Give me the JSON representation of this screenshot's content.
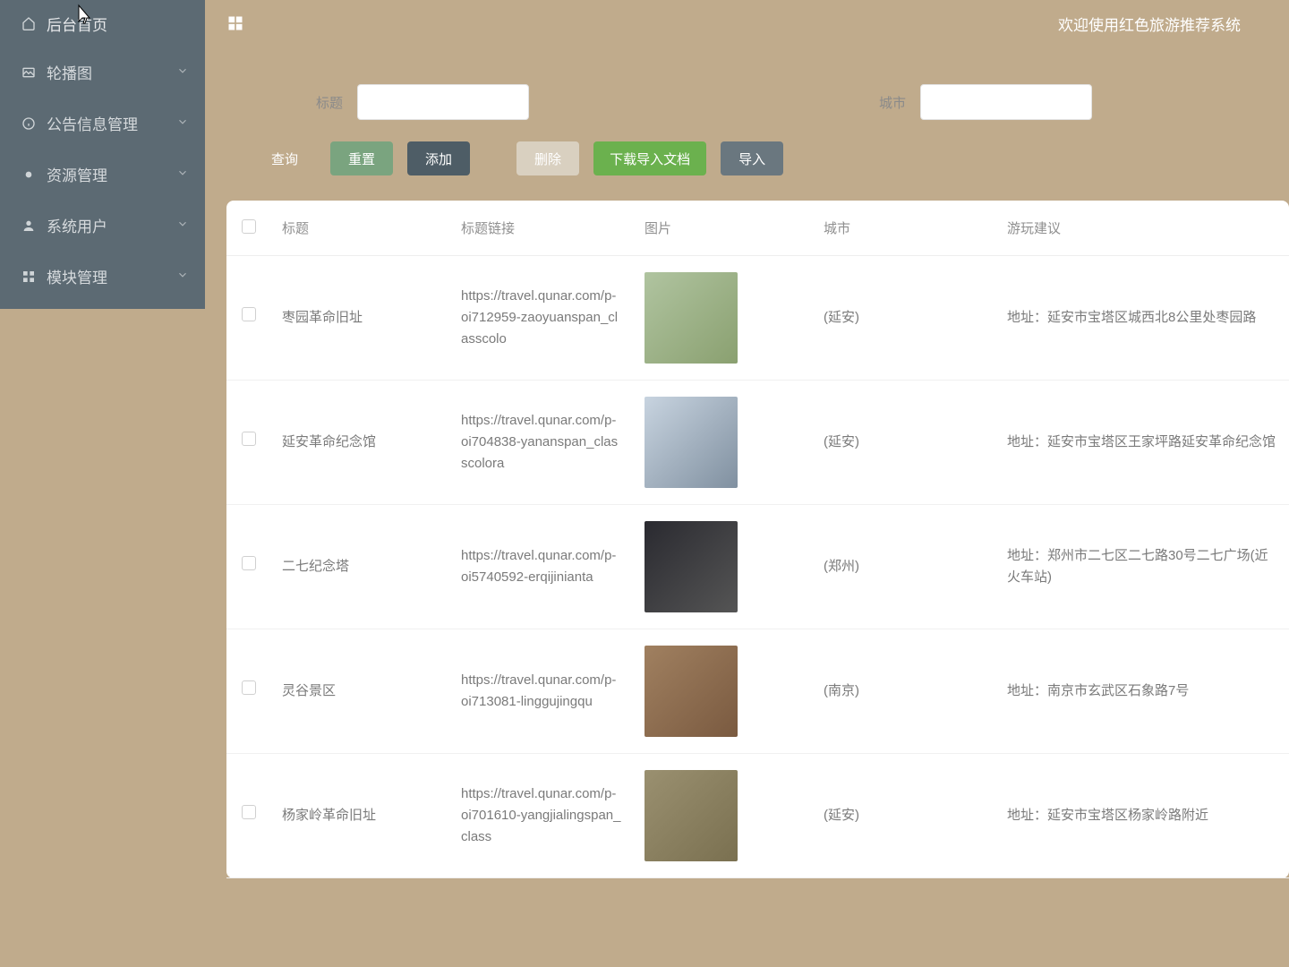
{
  "sidebar": {
    "home_label": "后台首页",
    "items": [
      {
        "label": "轮播图",
        "icon": "image"
      },
      {
        "label": "公告信息管理",
        "icon": "info"
      },
      {
        "label": "资源管理",
        "icon": "bulb"
      },
      {
        "label": "系统用户",
        "icon": "user"
      },
      {
        "label": "模块管理",
        "icon": "grid"
      }
    ]
  },
  "topbar": {
    "title": "欢迎使用红色旅游推荐系统"
  },
  "search": {
    "title_label": "标题",
    "city_label": "城市",
    "title_value": "",
    "city_value": ""
  },
  "buttons": {
    "query": "查询",
    "reset": "重置",
    "add": "添加",
    "delete": "删除",
    "download": "下载导入文档",
    "import": "导入"
  },
  "table": {
    "headers": {
      "title": "标题",
      "link": "标题链接",
      "image": "图片",
      "city": "城市",
      "advice": "游玩建议"
    },
    "rows": [
      {
        "title": "枣园革命旧址",
        "link": "https://travel.qunar.com/p-oi712959-zaoyuanspan_classcolo",
        "city": "(延安)",
        "advice": "地址：延安市宝塔区城西北8公里处枣园路",
        "img_class": "img-ph"
      },
      {
        "title": "延安革命纪念馆",
        "link": "https://travel.qunar.com/p-oi704838-yananspan_classcolora",
        "city": "(延安)",
        "advice": "地址：延安市宝塔区王家坪路延安革命纪念馆",
        "img_class": "img-ph bldg"
      },
      {
        "title": "二七纪念塔",
        "link": "https://travel.qunar.com/p-oi5740592-erqijinianta",
        "city": "(郑州)",
        "advice": "地址：郑州市二七区二七路30号二七广场(近火车站)",
        "img_class": "img-ph night"
      },
      {
        "title": "灵谷景区",
        "link": "https://travel.qunar.com/p-oi713081-linggujingqu",
        "city": "(南京)",
        "advice": "地址：南京市玄武区石象路7号",
        "img_class": "img-ph temple"
      },
      {
        "title": "杨家岭革命旧址",
        "link": "https://travel.qunar.com/p-oi701610-yangjialingspan_class",
        "city": "(延安)",
        "advice": "地址：延安市宝塔区杨家岭路附近",
        "img_class": "img-ph old"
      }
    ]
  }
}
